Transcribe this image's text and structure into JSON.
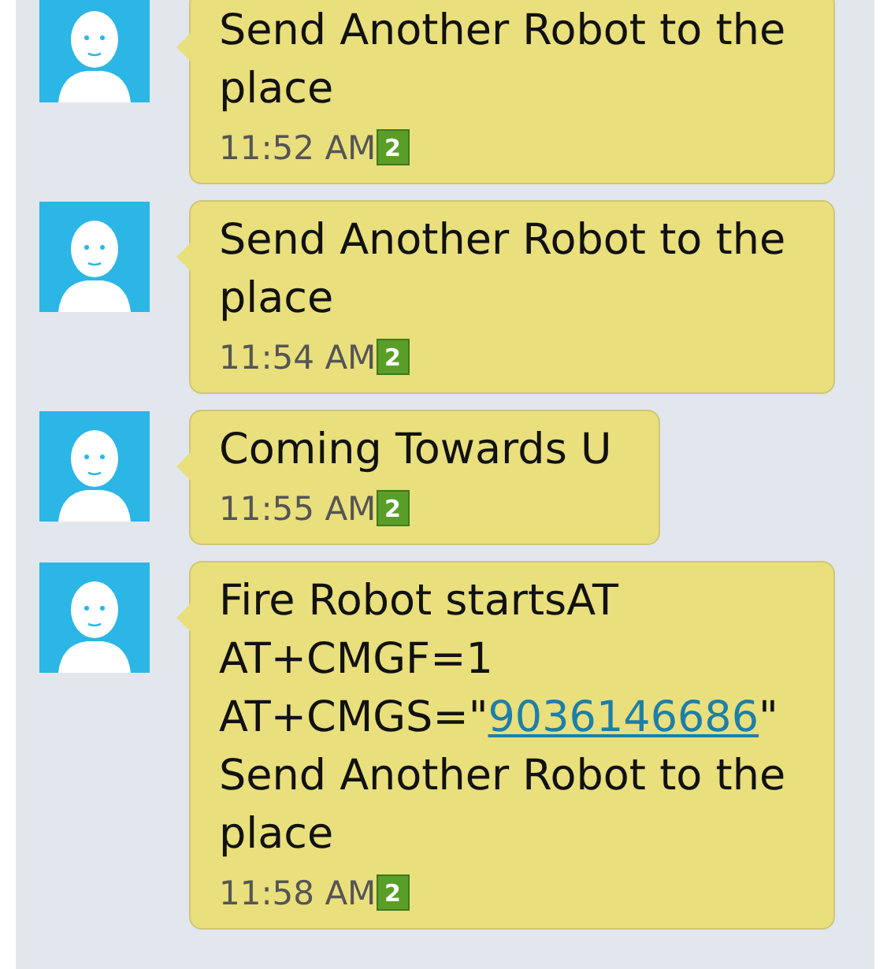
{
  "messages": [
    {
      "lines": [
        [
          {
            "kind": "text",
            "text": "Send Another Robot to the"
          }
        ],
        [
          {
            "kind": "text",
            "text": "place"
          }
        ]
      ],
      "time": "11:52 AM",
      "badge": "2"
    },
    {
      "lines": [
        [
          {
            "kind": "text",
            "text": "Send Another Robot to the"
          }
        ],
        [
          {
            "kind": "text",
            "text": "place"
          }
        ]
      ],
      "time": "11:54 AM",
      "badge": "2"
    },
    {
      "lines": [
        [
          {
            "kind": "text",
            "text": "Coming Towards U"
          }
        ]
      ],
      "time": "11:55 AM",
      "badge": "2"
    },
    {
      "lines": [
        [
          {
            "kind": "text",
            "text": "Fire Robot startsAT"
          }
        ],
        [
          {
            "kind": "text",
            "text": "AT+CMGF=1"
          }
        ],
        [
          {
            "kind": "text",
            "text": "AT+CMGS=\""
          },
          {
            "kind": "link",
            "text": "9036146686"
          },
          {
            "kind": "text",
            "text": "\""
          }
        ],
        [
          {
            "kind": "text",
            "text": "Send Another Robot to the"
          }
        ],
        [
          {
            "kind": "text",
            "text": "place"
          }
        ]
      ],
      "time": "11:58 AM",
      "badge": "2"
    }
  ]
}
